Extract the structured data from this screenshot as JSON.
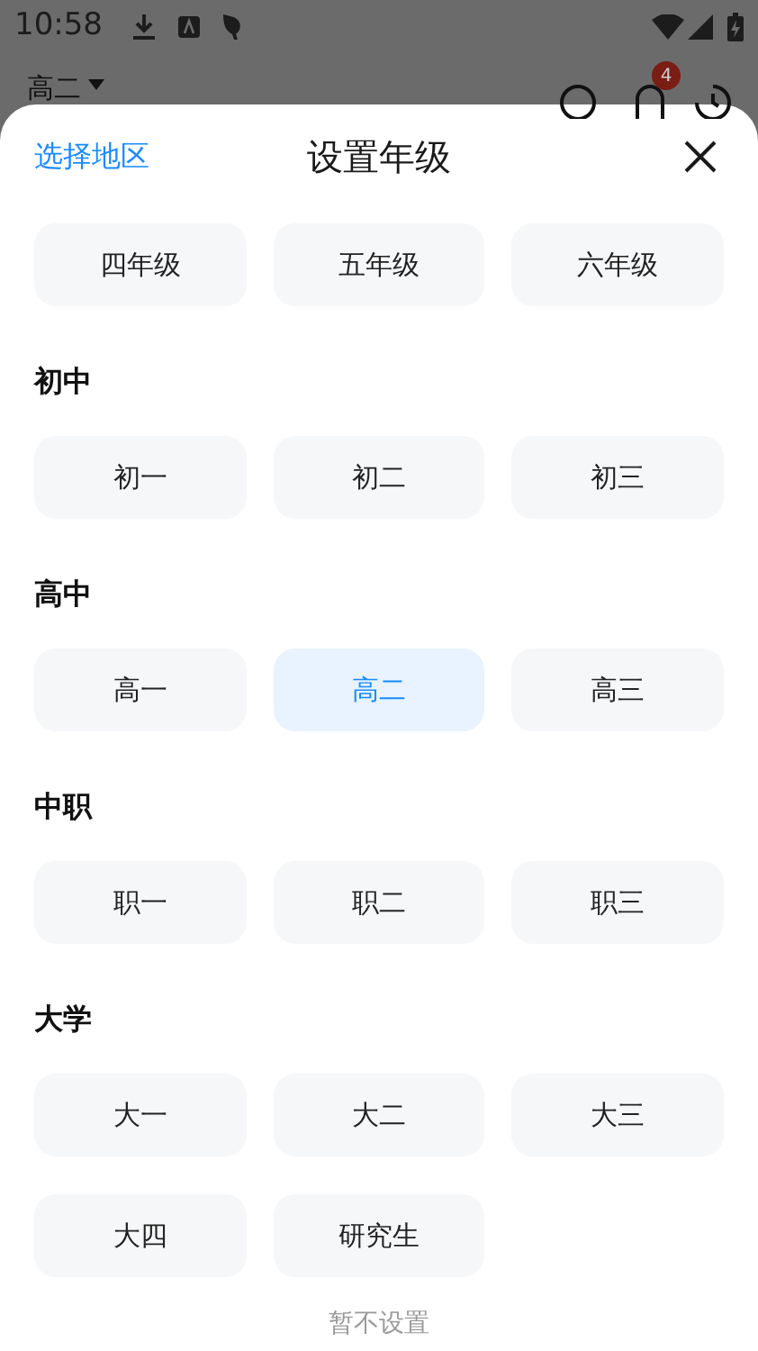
{
  "status_bar": {
    "time": "10:58"
  },
  "app_header": {
    "grade": "高二",
    "notification_badge": "4"
  },
  "sheet": {
    "region_link": "选择地区",
    "title": "设置年级",
    "sections": [
      {
        "options": [
          {
            "label": "四年级",
            "selected": false
          },
          {
            "label": "五年级",
            "selected": false
          },
          {
            "label": "六年级",
            "selected": false
          }
        ]
      },
      {
        "heading": "初中",
        "options": [
          {
            "label": "初一",
            "selected": false
          },
          {
            "label": "初二",
            "selected": false
          },
          {
            "label": "初三",
            "selected": false
          }
        ]
      },
      {
        "heading": "高中",
        "options": [
          {
            "label": "高一",
            "selected": false
          },
          {
            "label": "高二",
            "selected": true
          },
          {
            "label": "高三",
            "selected": false
          }
        ]
      },
      {
        "heading": "中职",
        "options": [
          {
            "label": "职一",
            "selected": false
          },
          {
            "label": "职二",
            "selected": false
          },
          {
            "label": "职三",
            "selected": false
          }
        ]
      },
      {
        "heading": "大学",
        "options": [
          {
            "label": "大一",
            "selected": false
          },
          {
            "label": "大二",
            "selected": false
          },
          {
            "label": "大三",
            "selected": false
          },
          {
            "label": "大四",
            "selected": false
          },
          {
            "label": "研究生",
            "selected": false
          }
        ]
      }
    ],
    "skip_label": "暂不设置"
  }
}
